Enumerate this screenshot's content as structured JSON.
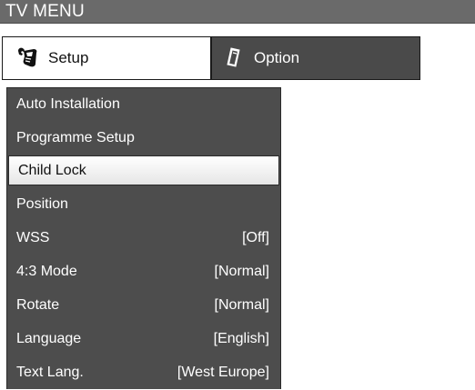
{
  "header": {
    "title": "TV MENU"
  },
  "tabs": [
    {
      "label": "Setup",
      "icon": "wrench-hand-icon",
      "active": true
    },
    {
      "label": "Option",
      "icon": "remote-control-icon",
      "active": false
    }
  ],
  "menu": {
    "items": [
      {
        "label": "Auto Installation",
        "value": ""
      },
      {
        "label": "Programme Setup",
        "value": ""
      },
      {
        "label": "Child Lock",
        "value": "",
        "selected": true
      },
      {
        "label": "Position",
        "value": ""
      },
      {
        "label": "WSS",
        "value": "[Off]"
      },
      {
        "label": "4:3 Mode",
        "value": "[Normal]"
      },
      {
        "label": "Rotate",
        "value": "[Normal]"
      },
      {
        "label": "Language",
        "value": "[English]"
      },
      {
        "label": "Text Lang.",
        "value": "[West Europe]"
      }
    ]
  },
  "colors": {
    "titlebar": "#6a6a6a",
    "menu_bg": "#4d4d4d",
    "selected_bg": "#f2f2f2",
    "inactive_tab": "#4a4a4a"
  }
}
